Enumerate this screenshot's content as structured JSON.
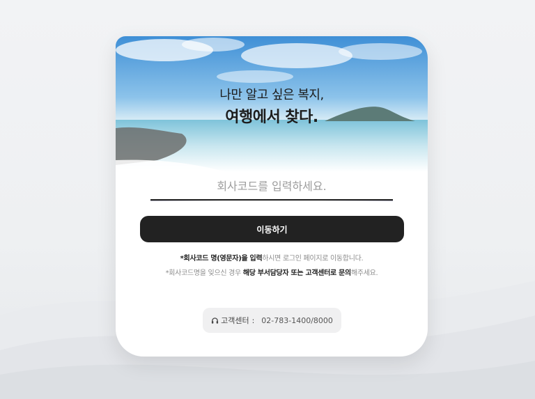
{
  "hero": {
    "line1": "나만 알고 싶은 복지,",
    "line2": "여행에서 찾다."
  },
  "form": {
    "company_code_placeholder": "회사코드를 입력하세요.",
    "submit_label": "이동하기"
  },
  "notes": {
    "line1_bold": "*회사코드 명(영문자)을 입력",
    "line1_rest": "하시면 로그인 페이지로 이동합니다.",
    "line2_prefix": "*회사코드명을 잊으신 경우 ",
    "line2_bold": "해당 부서담당자 또는 고객센터로 문의",
    "line2_suffix": "해주세요."
  },
  "support": {
    "icon": "headset-icon",
    "label": "고객센터",
    "colon": ":",
    "phone": "02-783-1400/8000"
  },
  "colors": {
    "button": "#222222",
    "accent_text": "#1e1e1e",
    "muted_text": "#8c8c8c"
  }
}
